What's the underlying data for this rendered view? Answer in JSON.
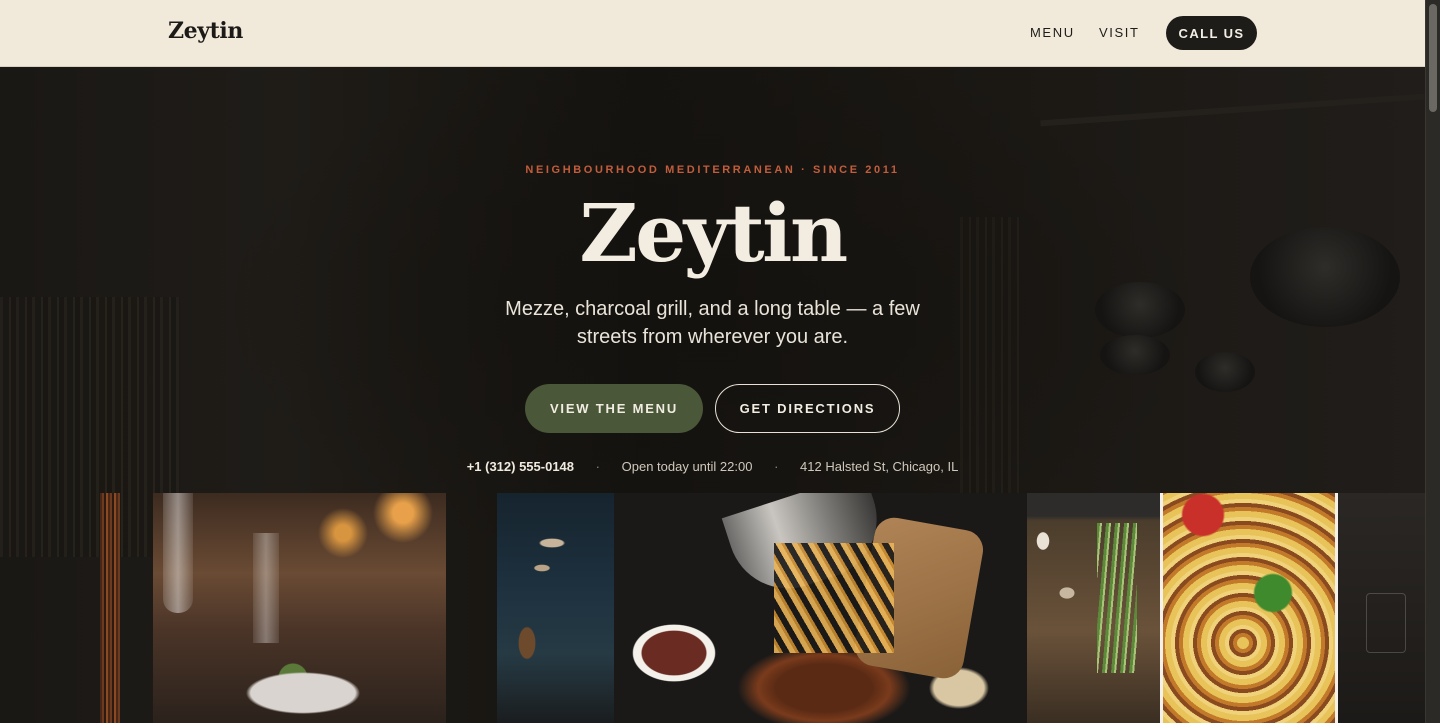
{
  "header": {
    "brand": "Zeytin",
    "nav": {
      "menu_label": "MENU",
      "visit_label": "VISIT",
      "call_label": "CALL US"
    }
  },
  "hero": {
    "eyebrow": "NEIGHBOURHOOD MEDITERRANEAN · SINCE 2011",
    "title": "Zeytin",
    "tagline": "Mezze, charcoal grill, and a long table — a few streets from wherever you are.",
    "primary_cta": "VIEW THE MENU",
    "secondary_cta": "GET DIRECTIONS",
    "info": {
      "phone": "+1 (312) 555-0148",
      "hours": "Open today until 22:00",
      "address": "412 Halsted St, Chicago, IL",
      "separator": "·"
    }
  },
  "colors": {
    "header_bg": "#f1eadb",
    "accent_terracotta": "#c25d3c",
    "primary_button": "#4a5738",
    "dark": "#1d1c19",
    "cream_text": "#f3ece0"
  }
}
